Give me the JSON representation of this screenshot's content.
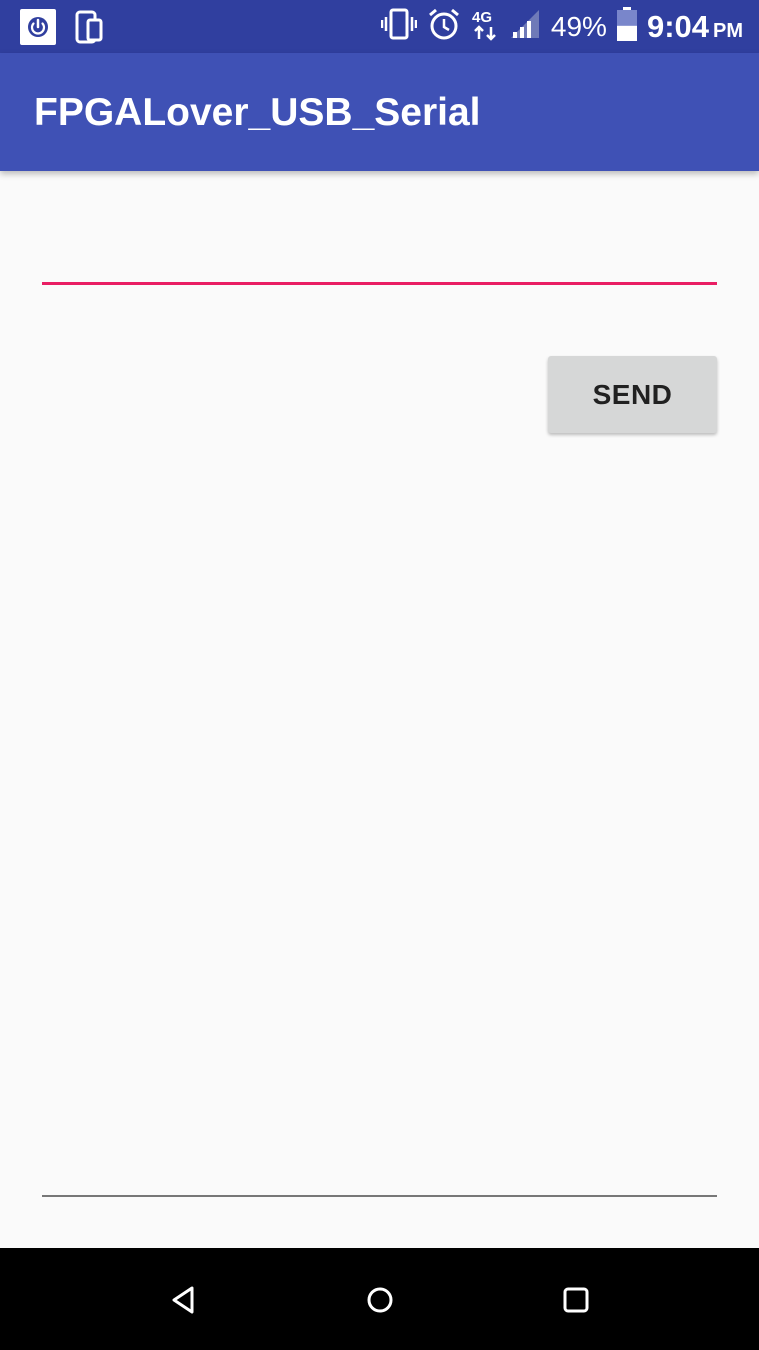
{
  "status_bar": {
    "left_icons": [
      "power-app-icon",
      "device-switch-icon"
    ],
    "right_icons": [
      "vibrate-icon",
      "alarm-icon",
      "4g-data-icon",
      "signal-icon"
    ],
    "battery_percent": "49%",
    "battery_level": 0.49,
    "time": "9:04",
    "ampm": "PM"
  },
  "app_bar": {
    "title": "FPGALover_USB_Serial",
    "color": "#3f51b5"
  },
  "form": {
    "input_value": "",
    "input_placeholder": "",
    "accent_color": "#e91e63",
    "send_label": "SEND"
  },
  "output": {
    "text": ""
  },
  "nav_bar": {
    "buttons": [
      "back-icon",
      "home-icon",
      "recents-icon"
    ]
  }
}
